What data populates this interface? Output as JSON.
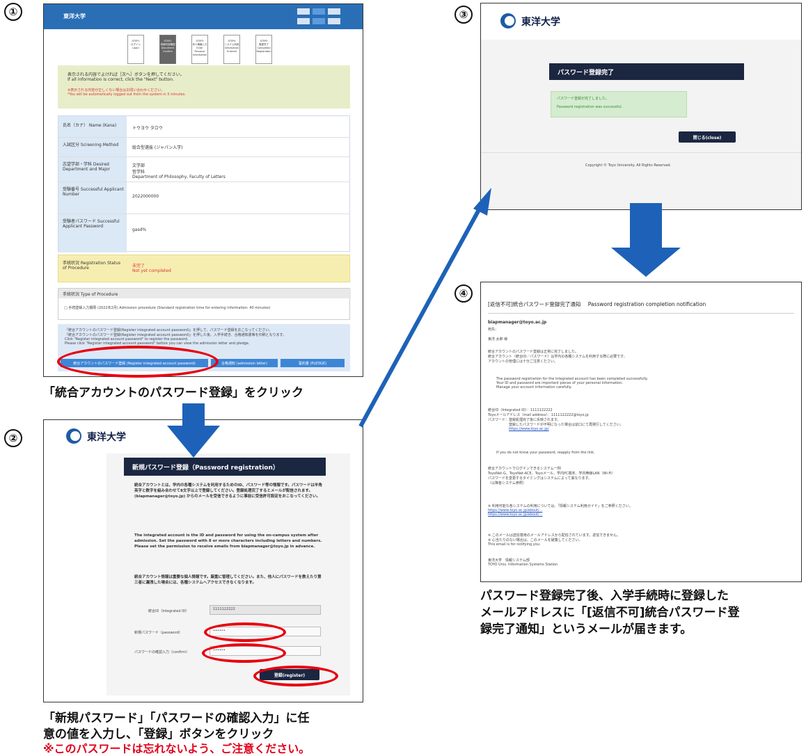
{
  "step_numbers": [
    "①",
    "②",
    "③",
    "④"
  ],
  "captions": {
    "step1": "「統合アカウントのパスワード登録」をクリック",
    "step2_line1": "「新規パスワード」「パスワードの確認入力」に任",
    "step2_line2": "意の値を入力し、「登録」ボタンをクリック",
    "step2_warning": "※このパスワードは忘れないよう、ご注意ください。",
    "step4_line1": "パスワード登録完了後、入学手続時に登録した",
    "step4_line2": "メールアドレスに「[返信不可]統合パスワード登",
    "step4_line3": "録完了通知」というメールが届きます。"
  },
  "screen1": {
    "header_title": "東洋大学",
    "steps": [
      "STEP1\nログイン\nLogin",
      "STEP2\n申請内容確認\nDocument\nConfirm",
      "STEP3\n本人情報入力\nEnter Personal\nInformation",
      "STEP4\nシステム利用\nInformation\nEntered",
      "STEP5\n登録完了\nCompleted\nRegistration"
    ],
    "notice_ja": "表示される内容でよければ［次へ］ボタンを押してください。",
    "notice_en": "If all information is correct, click the \"Next\" button.",
    "notice_red1": "※表示される内容が正しくない場合はお問い合わせください。",
    "notice_red2": "*You will be automatically logged out from the system in 5 minutes.",
    "fields": [
      {
        "label": "氏名（カナ）\nName (Kana)",
        "value": "トウヨウ タロウ"
      },
      {
        "label": "入試区分\nScreening Method",
        "value": "総合型選抜 (ジャパン入学)"
      },
      {
        "label": "志望学部・学科\nDesired Department and Major",
        "value": "文学部\n哲学科\nDepartment of Philosophy, Faculty of Letters"
      },
      {
        "label": "受験番号\nSuccessful Applicant Number",
        "value": "2022000000"
      },
      {
        "label": "受験者パスワード\nSuccessful Applicant Password",
        "value": "gasd%"
      }
    ],
    "status_label": "手続状況\nRegistration Status of Procedure",
    "status_value": "未完了\nNot yet completed",
    "procedure_header": "手続状況 Type of Procedure",
    "procedure_item": "□ 手続登録入力期限 (2022年2月) Admission procedure (Standard registration time for entering information: 40 minutes)",
    "bottom_note1": "「統合アカウントのパスワード登録(Register integrated account password)」を押して、パスワード登録をおこなってください。",
    "bottom_note2": "「統合アカウントのパスワード登録(Register integrated account password)」を押した後、入学手続き、合格通知書等を印刷となります。",
    "bottom_note3": "Click \"Register integrated account password\" to register the password.",
    "bottom_note4": "Please click \"Register integrated account password\" before you can view the admission letter and pledge.",
    "btn_register": "統合アカウントのパスワード登録 (Register integrated account password)",
    "btn_2": "合格通知 (admission letter)",
    "btn_3": "誓約書 (PLEDGE)"
  },
  "screen2": {
    "logo": "東洋大学",
    "title_bar": "新規パスワード登録（Password registration）",
    "para_ja": "統合アカウントとは、学内の各種システムを利用するためのID、パスワード等の情報です。パスワードは半角英字と数字を組み合わせて8文字以上で登録してください。登録処理完了するとメールが配信されます。(biapmanager@toyo.jp) からのメールを受信できるように事前に受信許可設定をおこなってください。",
    "para_en": "The integrated account is the ID and password for using the on-campus system after admission. Set the password with 8 or more characters including letters and numbers. Please set the permission to receive emails from biapmanager@toyo.jp in advance.",
    "para_ja2": "統合アカウント情報は重要な個人情報です。厳重に管理してください。また、他人にパスワードを教えたり第三者に漏洩した場合には、各種システムへアクセスできなくなります。",
    "id_label": "統合ID（Integrated ID）",
    "id_value": "1111122222",
    "new_pw_label": "新規パスワード（password）",
    "confirm_pw_label": "パスワードの確認入力（confirm）",
    "new_pw_value": "••••••",
    "confirm_pw_value": "••••••",
    "register_btn": "登録(register)"
  },
  "screen3": {
    "logo": "東洋大学",
    "title_bar": "パスワード登録完了",
    "success_ja": "パスワード登録が完了しました。",
    "success_en": "Password registration was successful.",
    "close_btn": "閉じる(close)",
    "copyright": "Copyright © Toyo University. All Rights Reserved."
  },
  "screen4": {
    "subject_ja": "[返信不可]統合パスワード登録完了通知",
    "subject_en": "Password registration completion notification",
    "from": "biapmanager@toyo.ac.jp",
    "to": "宛先：",
    "greeting": "東洋 太郎 様",
    "body_ja": [
      "統合アカウントのパスワード登録は正常に完了しました。",
      "統合アカウント（統合ID／パスワード）は学内の各種システムを利用する際に必要です。",
      "アカウントの管理には十分ご注意ください。"
    ],
    "body_en": [
      "The password registration for the integrated account has been completed successfully.",
      "Your ID and password are important pieces of your personal information.",
      "Manage your account information carefully."
    ],
    "info_lines": [
      "統合ID（Integrated ID）：1111122222",
      "Toyoメールアドレス（mail address）：1111122222@toyo.jp",
      "パスワード：登録処理完了後に反映されます。",
      "登録したパスワードが不明になった場合は窓口にて再発行してください。"
    ],
    "link1": "https://www.toyo.ac.jp/",
    "note_en": "If you do not know your password, reapply from the link.",
    "section2": [
      "統合アカウントでログインできるシステム一例",
      "ToyoNet-G、ToyoNet-ACE、Toyoメール、学内PC端末、学内無線LAN（Wi-Fi）",
      "パスワードを変更するタイミングはシステムによって異なります。",
      "（以降各システム参照）"
    ],
    "section3": [
      "※ 利用可能な各システムの利用については、「情報システム利用ガイド」をご参照ください。"
    ],
    "links": [
      "https://www.toyo.ac.jp/about/...",
      "https://www.toyo.ac.jp/about/..."
    ],
    "footer_lines": [
      "※ このメールは送信専用のメールアドレスから配信されています。返信できません。",
      "※ 心当たりのない場合は、このメールを破棄してください。",
      "This email is for notifying you."
    ],
    "signature": [
      "東洋大学　情報システム部",
      "TOYO Univ. Information Systems Station"
    ]
  }
}
